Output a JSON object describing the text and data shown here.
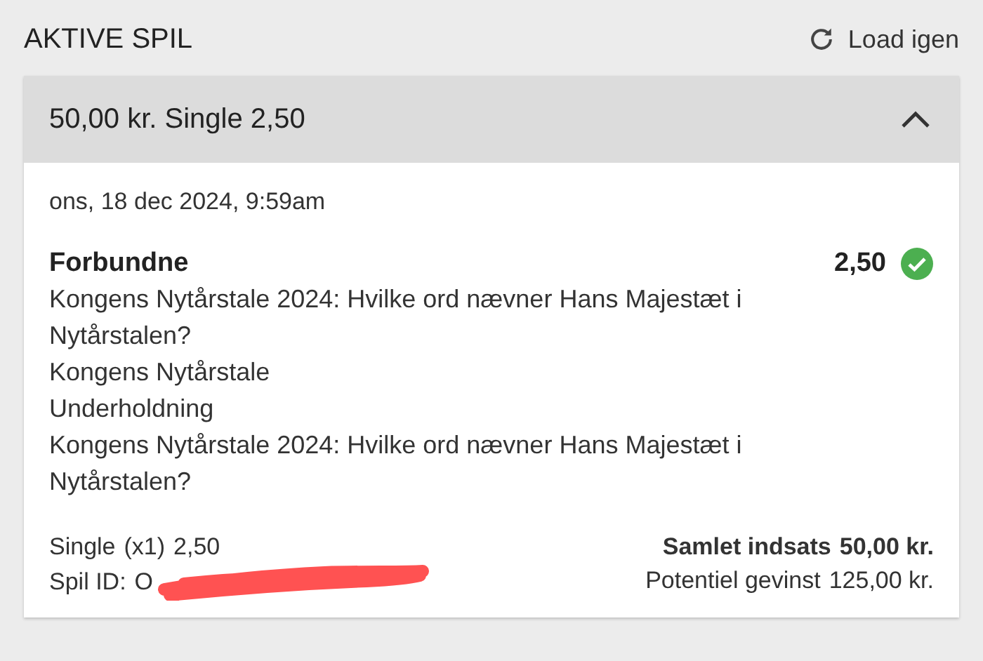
{
  "header": {
    "title": "AKTIVE SPIL",
    "reload_label": "Load igen"
  },
  "bet": {
    "summary": "50,00 kr. Single 2,50",
    "expanded": true,
    "date": "ons, 18 dec 2024, 9:59am",
    "selection": {
      "title": "Forbundne",
      "odds": "2,50",
      "lines": [
        "Kongens Nytårstale 2024: Hvilke ord nævner Hans Majestæt i Nytårstalen?",
        "Kongens Nytårstale",
        "Underholdning",
        "Kongens Nytårstale 2024: Hvilke ord nævner Hans Majestæt i Nytårstalen?"
      ]
    },
    "footer": {
      "type_label": "Single",
      "multiplier": "(x1)",
      "type_odds": "2,50",
      "id_label": "Spil ID:",
      "id_value": "O",
      "stake_label": "Samlet indsats",
      "stake_value": "50,00 kr.",
      "win_label": "Potentiel gevinst",
      "win_value": "125,00 kr."
    }
  }
}
